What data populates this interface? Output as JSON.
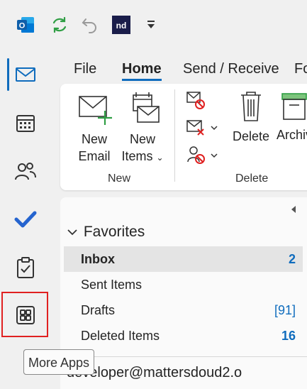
{
  "titlebar": {
    "icons": [
      "outlook-logo-icon",
      "sync-icon",
      "undo-icon",
      "addin-icon",
      "customize-toolbar-icon"
    ],
    "addin_label": "nd"
  },
  "rail": {
    "items": [
      "mail-icon",
      "calendar-icon",
      "people-icon",
      "todo-icon",
      "tasks-icon",
      "more-apps-icon"
    ],
    "tooltip": "More Apps"
  },
  "ribbon": {
    "tabs": [
      "File",
      "Home",
      "Send / Receive",
      "Fo"
    ],
    "active_tab": "Home",
    "new_group": {
      "label": "New",
      "new_email_line1": "New",
      "new_email_line2": "Email",
      "new_items_line1": "New",
      "new_items_line2": "Items"
    },
    "delete_group": {
      "label": "Delete",
      "delete_label": "Delete",
      "archive_label": "Archiv"
    }
  },
  "folders": {
    "favorites_label": "Favorites",
    "items": [
      {
        "name": "Inbox",
        "count": "2"
      },
      {
        "name": "Sent Items",
        "count": ""
      },
      {
        "name": "Drafts",
        "count": "[91]"
      },
      {
        "name": "Deleted Items",
        "count": "16"
      }
    ],
    "account": "developer@mattersdoud2.o"
  },
  "colors": {
    "accent": "#0f6cbd",
    "highlight_box": "#e02020",
    "background": "#f0f0f0"
  }
}
